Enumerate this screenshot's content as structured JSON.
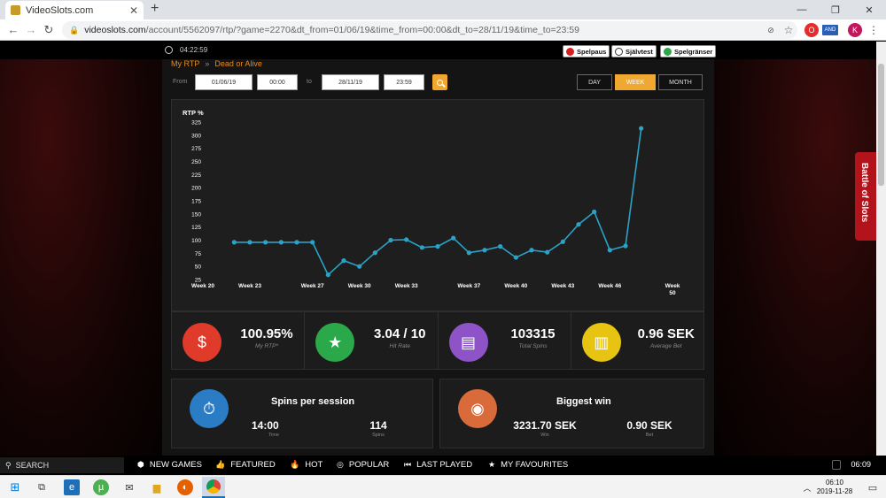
{
  "browser": {
    "tab_title": "VideoSlots.com",
    "tab_close": "✕",
    "new_tab": "+",
    "url_host": "videoslots.com",
    "url_path": "/account/5562097/rtp/?game=2270&dt_from=01/06/19&time_from=00:00&dt_to=28/11/19&time_to=23:59",
    "profile_initial": "K",
    "ext_badge": "AND"
  },
  "site_top": {
    "time": "04:22:59",
    "rg_buttons": [
      "Spelpaus",
      "Självtest",
      "Spelgränser"
    ]
  },
  "breadcrumb": {
    "first": "My RTP",
    "separator": "»",
    "second": "Dead or Alive"
  },
  "filters": {
    "from_label": "From",
    "from_date": "01/06/19",
    "from_time": "00:00",
    "to_label": "to",
    "to_date": "28/11/19",
    "to_time": "23:59",
    "periods": [
      "DAY",
      "WEEK",
      "MONTH"
    ],
    "active_period": "WEEK"
  },
  "chart_data": {
    "type": "line",
    "title": "",
    "ylabel": "RTP %",
    "xlabel": "",
    "ylim": [
      25,
      325
    ],
    "yticks": [
      25,
      50,
      75,
      100,
      125,
      150,
      175,
      200,
      225,
      250,
      275,
      300,
      325
    ],
    "xticks": [
      "Week 20",
      "Week 23",
      "Week 27",
      "Week 30",
      "Week 33",
      "Week 37",
      "Week 40",
      "Week 43",
      "Week 46",
      "Week 50"
    ],
    "x": [
      22,
      23,
      24,
      25,
      26,
      27,
      28,
      29,
      30,
      31,
      32,
      33,
      34,
      35,
      36,
      37,
      38,
      39,
      40,
      41,
      42,
      43,
      44,
      45,
      46,
      47,
      48
    ],
    "values": [
      96,
      96,
      96,
      96,
      96,
      96,
      34,
      61,
      50,
      76,
      100,
      101,
      86,
      88,
      104,
      76,
      81,
      88,
      67,
      81,
      77,
      97,
      130,
      154,
      81,
      89,
      313
    ],
    "color": "#2aa3c8",
    "grid": false
  },
  "stats": [
    {
      "value": "100.95%",
      "label": "My RTP*",
      "icon": "money-hand-icon",
      "color": "#e03a2a"
    },
    {
      "value": "3.04 / 10",
      "label": "Hit Rate",
      "icon": "star-icon",
      "color": "#2aa84a"
    },
    {
      "value": "103315",
      "label": "Total Spins",
      "icon": "slot-machine-icon",
      "color": "#8e54c7"
    },
    {
      "value": "0.96 SEK",
      "label": "Average Bet",
      "icon": "casino-building-icon",
      "color": "#e8c412"
    }
  ],
  "spins_session": {
    "title": "Spins per session",
    "time_value": "14:00",
    "time_label": "Time",
    "spins_value": "114",
    "spins_label": "Spins",
    "color": "#2a7cc4"
  },
  "biggest_win": {
    "title": "Biggest win",
    "win_value": "3231.70 SEK",
    "win_label": "Win",
    "bet_value": "0.90 SEK",
    "bet_label": "Bet",
    "color": "#d96a3a"
  },
  "side_tab": "Battle of Slots",
  "site_nav": {
    "search": "SEARCH",
    "items": [
      "NEW GAMES",
      "FEATURED",
      "HOT",
      "POPULAR",
      "LAST PLAYED",
      "MY FAVOURITES"
    ],
    "time": "06:09"
  },
  "taskbar": {
    "time": "06:10",
    "date": "2019-11-28"
  }
}
